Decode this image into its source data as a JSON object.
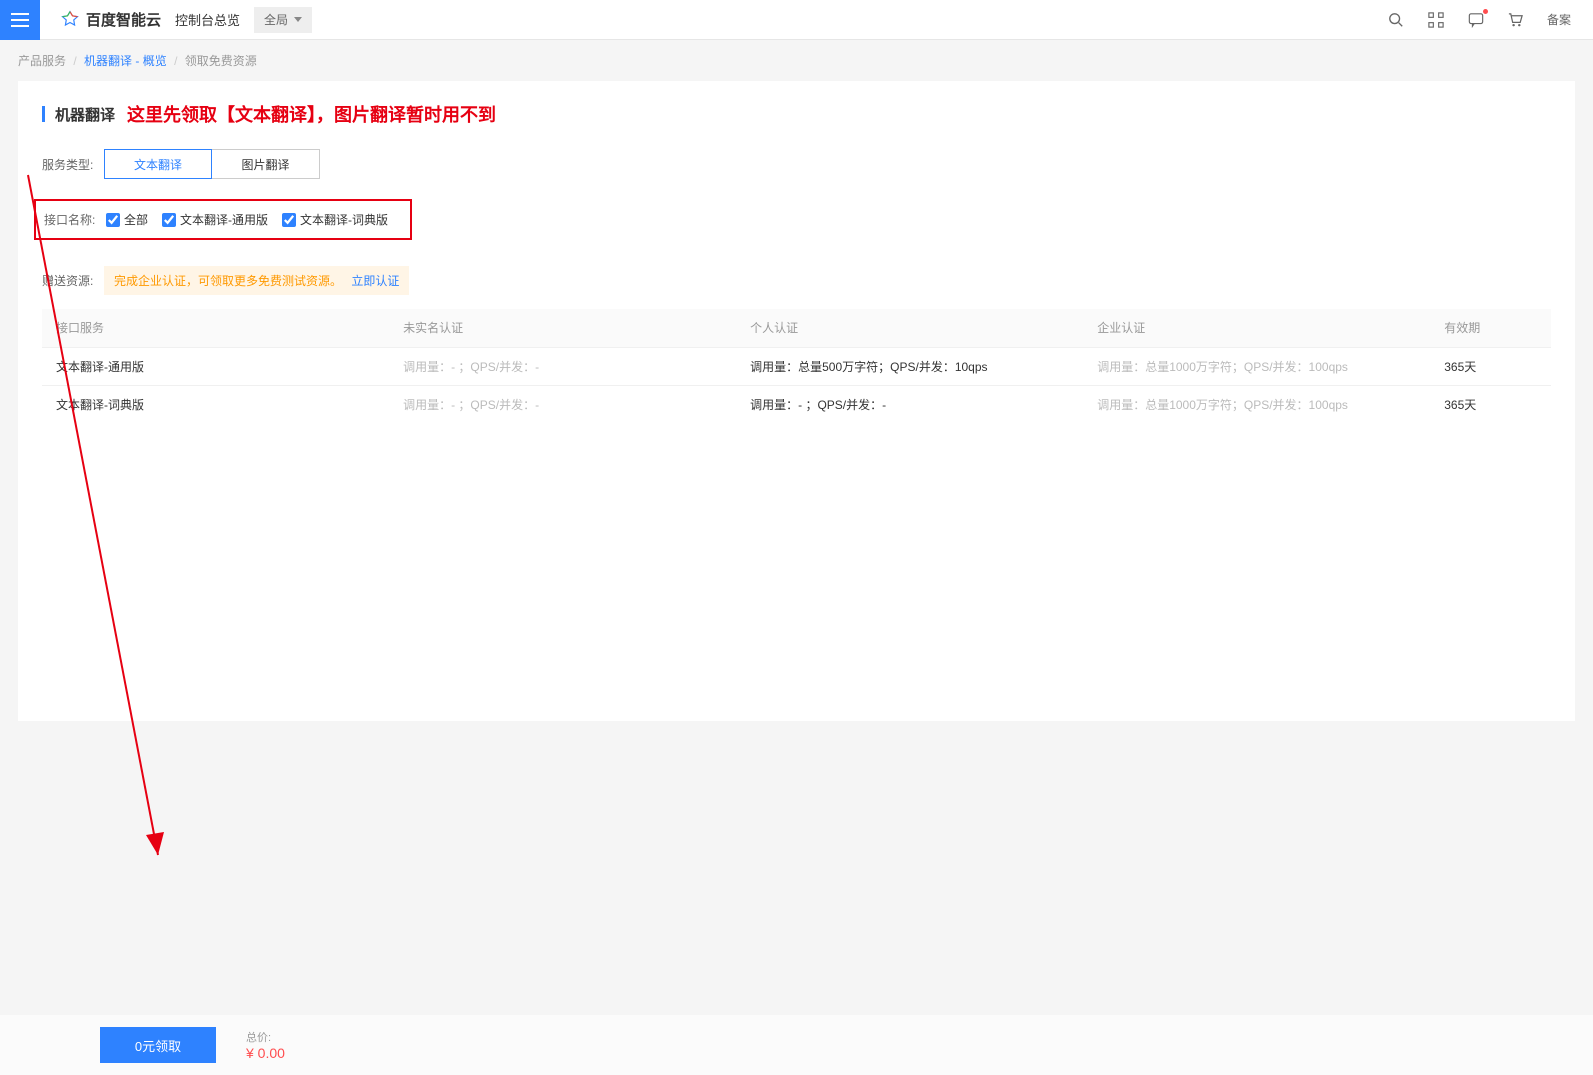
{
  "header": {
    "brand": "百度智能云",
    "console_title": "控制台总览",
    "scope": "全局",
    "support_label": "备案"
  },
  "breadcrumb": {
    "item1": "产品服务",
    "item2": "机器翻译 - 概览",
    "item3": "领取免费资源"
  },
  "page": {
    "title": "机器翻译",
    "red_note": "这里先领取【文本翻译】，图片翻译暂时用不到",
    "service_type_label": "服务类型:",
    "tab_text": "文本翻译",
    "tab_image": "图片翻译",
    "interface_label": "接口名称:",
    "cb_all": "全部",
    "cb_general": "文本翻译-通用版",
    "cb_dict": "文本翻译-词典版",
    "gift_label": "赠送资源:",
    "gift_tip": "完成企业认证，可领取更多免费测试资源。",
    "gift_link": "立即认证"
  },
  "table": {
    "headers": {
      "service": "接口服务",
      "no_auth": "未实名认证",
      "personal": "个人认证",
      "enterprise": "企业认证",
      "valid": "有效期"
    },
    "rows": [
      {
        "service": "文本翻译-通用版",
        "no_auth": "调用量：- ；QPS/并发：-",
        "personal": "调用量：总量500万字符；QPS/并发：10qps",
        "enterprise": "调用量：总量1000万字符；QPS/并发：100qps",
        "valid": "365天"
      },
      {
        "service": "文本翻译-词典版",
        "no_auth": "调用量：- ；QPS/并发：-",
        "personal": "调用量：- ；QPS/并发：-",
        "enterprise": "调用量：总量1000万字符；QPS/并发：100qps",
        "valid": "365天"
      }
    ]
  },
  "footer": {
    "claim_btn": "0元领取",
    "total_label": "总价:",
    "total_value": "¥ 0.00"
  }
}
